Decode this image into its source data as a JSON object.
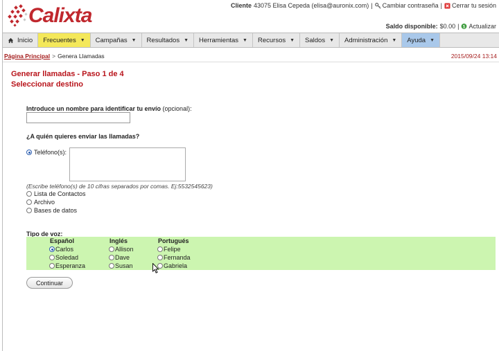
{
  "brand": {
    "name": "Calixta"
  },
  "header": {
    "client_label": "Cliente",
    "client_info": "43075 Elisa Cepeda (elisa@auronix.com)",
    "divider": "|",
    "change_password": "Cambiar contraseña",
    "logout": "Cerrar tu sesión",
    "balance_label": "Saldo disponible:",
    "balance_value": "$0.00",
    "update": "Actualizar"
  },
  "nav": {
    "items": [
      {
        "label": "Inicio"
      },
      {
        "label": "Frecuentes"
      },
      {
        "label": "Campañas"
      },
      {
        "label": "Resultados"
      },
      {
        "label": "Herramientas"
      },
      {
        "label": "Recursos"
      },
      {
        "label": "Saldos"
      },
      {
        "label": "Administración"
      },
      {
        "label": "Ayuda"
      }
    ]
  },
  "breadcrumb": {
    "home": "Página Principal",
    "separator": ">",
    "current": "Genera Llamadas",
    "datetime": "2015/09/24 13:14"
  },
  "page": {
    "title_step": "Generar llamadas - Paso 1 de 4",
    "title_sub": "Seleccionar destino"
  },
  "form": {
    "name_label": "Introduce un nombre para identificar tu envío",
    "name_optional": "(opcional):",
    "name_value": "",
    "target_question": "¿A quién quieres enviar las llamadas?",
    "phone_label": "Teléfono(s):",
    "phone_note": "(Escribe teléfono(s) de 10 cifras separados por comas. Ej:5532545623)",
    "options": [
      "Lista de Contactos",
      "Archivo",
      "Bases de datos"
    ],
    "voice_label": "Tipo de voz:",
    "voices": {
      "spanish": {
        "header": "Español",
        "names": [
          "Carlos",
          "Soledad",
          "Esperanza"
        ]
      },
      "english": {
        "header": "Inglés",
        "names": [
          "Allison",
          "Dave",
          "Susan"
        ]
      },
      "portuguese": {
        "header": "Portugués",
        "names": [
          "Felipe",
          "Fernanda",
          "Gabriela"
        ]
      }
    },
    "selected_voice": "Carlos",
    "continue_button": "Continuar"
  },
  "colors": {
    "accent": "#b8141b",
    "active_tab": "#f4e85a",
    "help_tab": "#a9c8ea",
    "voice_bg": "#ccf5b0"
  }
}
